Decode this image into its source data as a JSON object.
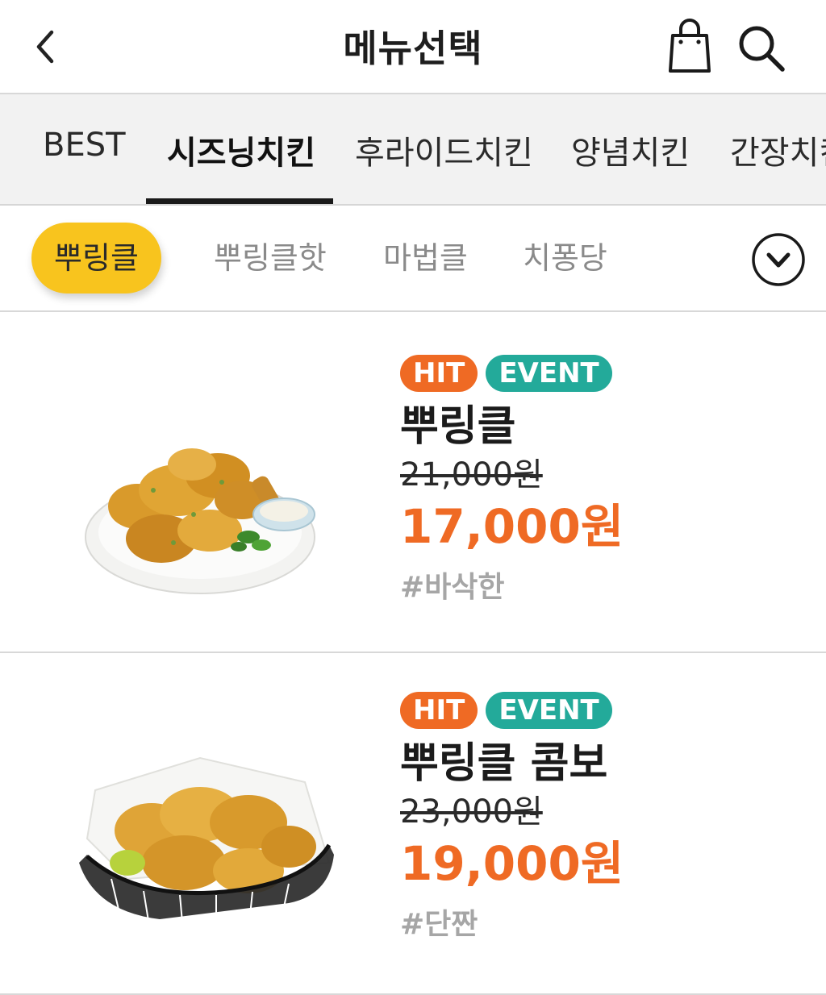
{
  "header": {
    "title": "메뉴선택"
  },
  "categories": [
    {
      "label": "BEST"
    },
    {
      "label": "시즈닝치킨"
    },
    {
      "label": "후라이드치킨"
    },
    {
      "label": "양념치킨"
    },
    {
      "label": "간장치킨"
    }
  ],
  "active_category": "시즈닝치킨",
  "subcategories": [
    {
      "label": "뿌링클"
    },
    {
      "label": "뿌링클핫"
    },
    {
      "label": "마법클"
    },
    {
      "label": "치퐁당"
    }
  ],
  "active_subcategory": "뿌링클",
  "products": [
    {
      "badges": [
        "HIT",
        "EVENT"
      ],
      "name": "뿌링클",
      "original_price": "21,000원",
      "sale_price": "17,000원",
      "hashtag": "#바삭한"
    },
    {
      "badges": [
        "HIT",
        "EVENT"
      ],
      "name": "뿌링클 콤보",
      "original_price": "23,000원",
      "sale_price": "19,000원",
      "hashtag": "#단짠"
    }
  ],
  "colors": {
    "accent_yellow": "#f8c41e",
    "price_orange": "#ef6a24",
    "event_teal": "#23aa9a",
    "hashtag_gray": "#a6a6a6"
  },
  "icons": {
    "back": "chevron-left-icon",
    "cart": "shopping-bag-icon",
    "search": "search-icon",
    "expand": "chevron-down-circle-icon"
  }
}
